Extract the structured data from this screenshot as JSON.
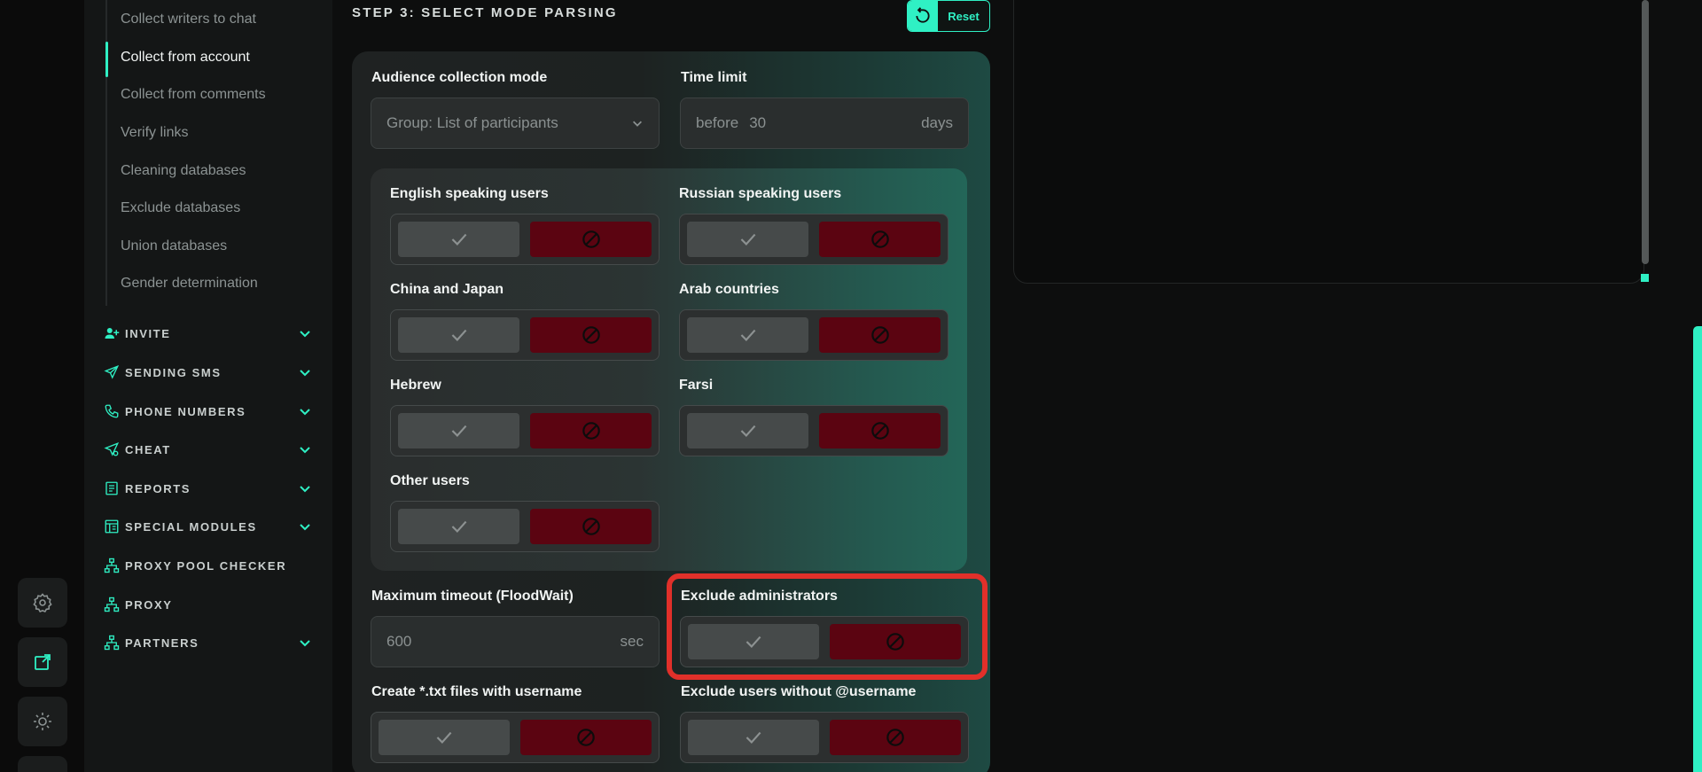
{
  "sidebar": {
    "subitems": [
      {
        "label": "Collect writers to chat",
        "active": false
      },
      {
        "label": "Collect from account",
        "active": true
      },
      {
        "label": "Collect from comments",
        "active": false
      },
      {
        "label": "Verify links",
        "active": false
      },
      {
        "label": "Cleaning databases",
        "active": false
      },
      {
        "label": "Exclude databases",
        "active": false
      },
      {
        "label": "Union databases",
        "active": false
      },
      {
        "label": "Gender determination",
        "active": false
      }
    ],
    "nav": [
      {
        "label": "INVITE",
        "icon": "user-plus-icon",
        "expandable": true
      },
      {
        "label": "SENDING SMS",
        "icon": "send-icon",
        "expandable": true
      },
      {
        "label": "PHONE NUMBERS",
        "icon": "phone-icon",
        "expandable": true
      },
      {
        "label": "CHEAT",
        "icon": "send-star-icon",
        "expandable": true
      },
      {
        "label": "REPORTS",
        "icon": "report-icon",
        "expandable": true
      },
      {
        "label": "SPECIAL MODULES",
        "icon": "module-icon",
        "expandable": true
      },
      {
        "label": "PROXY POOL CHECKER",
        "icon": "network-icon",
        "expandable": false
      },
      {
        "label": "PROXY",
        "icon": "network-icon",
        "expandable": false
      },
      {
        "label": "PARTNERS",
        "icon": "network-icon",
        "expandable": true
      }
    ]
  },
  "rail": {
    "buttons": [
      "settings-icon",
      "external-link-icon",
      "theme-sun-icon"
    ]
  },
  "main": {
    "step_title": "STEP 3: SELECT MODE PARSING",
    "reset_label": "Reset",
    "audience_label": "Audience collection mode",
    "audience_value": "Group: List of participants",
    "time_limit_label": "Time limit",
    "time_prefix": "before",
    "time_value": "30",
    "time_unit": "days",
    "languages": [
      {
        "label": "English speaking users"
      },
      {
        "label": "Russian speaking users"
      },
      {
        "label": "China and Japan"
      },
      {
        "label": "Arab countries"
      },
      {
        "label": "Hebrew"
      },
      {
        "label": "Farsi"
      },
      {
        "label": "Other users"
      }
    ],
    "timeout_label": "Maximum timeout (FloodWait)",
    "timeout_placeholder": "600",
    "timeout_unit": "sec",
    "exclude_admins_label": "Exclude administrators",
    "create_txt_label": "Create *.txt files with username",
    "exclude_no_username_label": "Exclude users without @username"
  },
  "colors": {
    "accent": "#2ff0c4",
    "deny": "#5b0411",
    "highlight": "#e1302a"
  }
}
